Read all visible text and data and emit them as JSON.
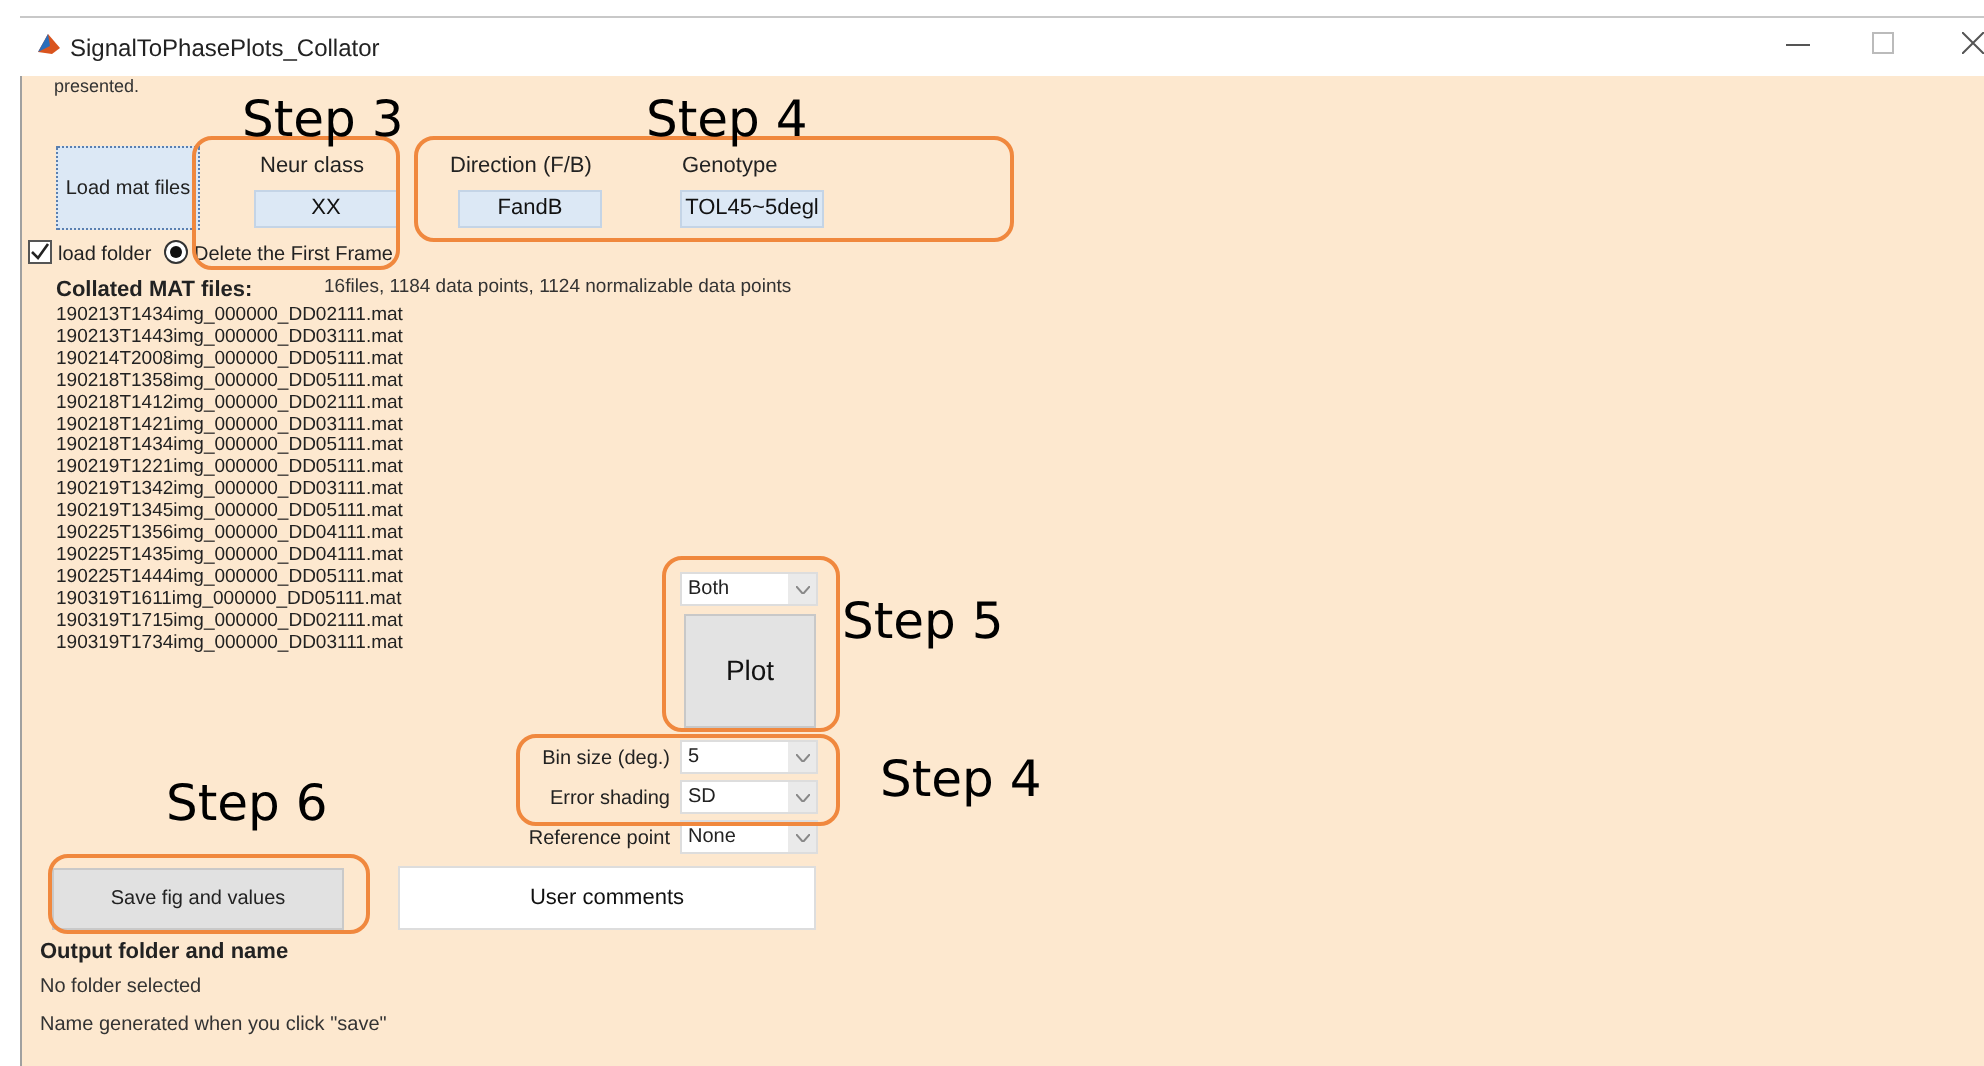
{
  "window": {
    "title": "SignalToPhasePlots_Collator"
  },
  "top_text": "presented.",
  "load_button": "Load mat files",
  "fields": [
    {
      "label": "Neur class",
      "value": "XX"
    },
    {
      "label": "Direction (F/B)",
      "value": "FandB"
    },
    {
      "label": "Genotype",
      "value": "TOL45~5degl"
    }
  ],
  "load_folder": {
    "label": "load folder",
    "checked": true
  },
  "delete_first_frame": {
    "label": "Delete the First Frame",
    "selected": true
  },
  "collated": {
    "heading": "Collated MAT files:",
    "summary": "16files, 1184 data points, 1124 normalizable data points",
    "files": [
      "190213T1434img_000000_DD02111.mat",
      "190213T1443img_000000_DD03111.mat",
      "190214T2008img_000000_DD05111.mat",
      "190218T1358img_000000_DD05111.mat",
      "190218T1412img_000000_DD02111.mat",
      "190218T1421img_000000_DD03111.mat",
      "190218T1434img_000000_DD05111.mat",
      "190219T1221img_000000_DD05111.mat",
      "190219T1342img_000000_DD03111.mat",
      "190219T1345img_000000_DD05111.mat",
      "190225T1356img_000000_DD04111.mat",
      "190225T1435img_000000_DD04111.mat",
      "190225T1444img_000000_DD05111.mat",
      "190319T1611img_000000_DD05111.mat",
      "190319T1715img_000000_DD02111.mat",
      "190319T1734img_000000_DD03111.mat"
    ]
  },
  "plot_mode": "Both",
  "plot_button": "Plot",
  "options": [
    {
      "label": "Bin size (deg.)",
      "value": "5"
    },
    {
      "label": "Error shading",
      "value": "SD"
    },
    {
      "label": "Reference point",
      "value": "None"
    }
  ],
  "save_button": "Save fig and values",
  "comments_button": "User comments",
  "output": {
    "heading": "Output folder and name",
    "folder": "No folder selected",
    "name": "Name generated when you click \"save\""
  },
  "annotations": [
    "Step 3",
    "Step 4",
    "Step 5",
    "Step 4",
    "Step 6"
  ]
}
